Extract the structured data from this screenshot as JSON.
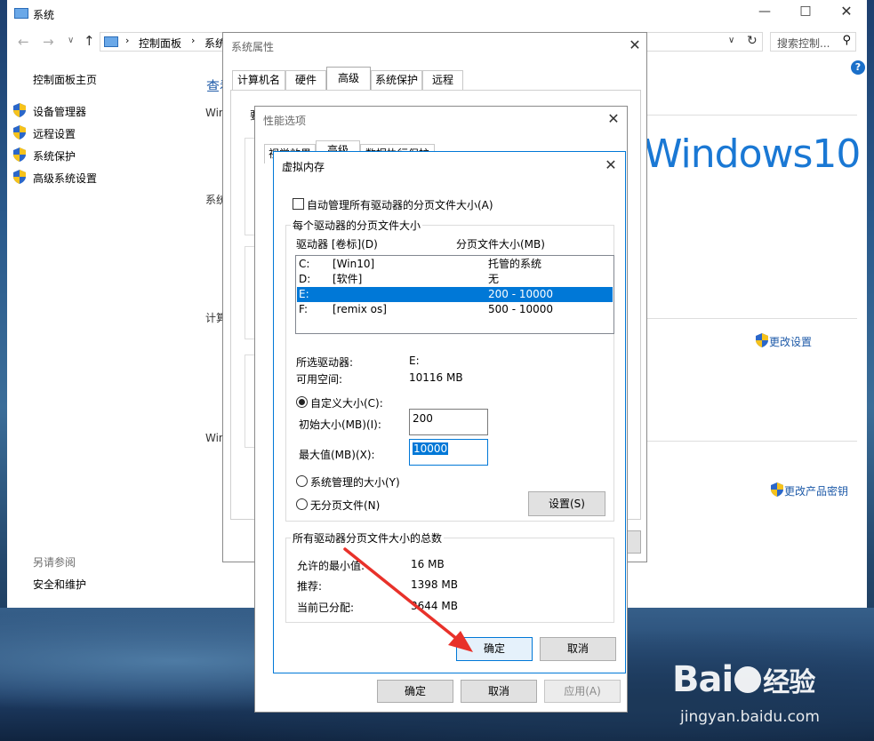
{
  "system_window": {
    "title": "系统",
    "address": {
      "crumb1": "控制面板",
      "crumb2": "系统"
    },
    "search_placeholder": "搜索控制...",
    "sidebar": {
      "home": "控制面板主页",
      "items": [
        {
          "label": "设备管理器"
        },
        {
          "label": "远程设置"
        },
        {
          "label": "系统保护"
        },
        {
          "label": "高级系统设置"
        }
      ],
      "see_also": "另请参阅",
      "security": "安全和维护"
    },
    "main": {
      "heading_fragment": "查看",
      "win_label_1": "Win",
      "sys_label": "系统",
      "calc_label": "计算",
      "win_label_2": "Win",
      "brand": "Windows10",
      "change_settings": "更改设置",
      "change_key": "更改产品密钥"
    }
  },
  "sys_props": {
    "title": "系统属性",
    "tabs": [
      "计算机名",
      "硬件",
      "高级",
      "系统保护",
      "远程"
    ],
    "stub_text": "要",
    "buttons": {
      "ok": "确定",
      "cancel": "取消",
      "apply": "应用(A)"
    }
  },
  "perf_options": {
    "title": "性能选项",
    "tabs": [
      "视觉效果",
      "高级",
      "数据执行保护"
    ]
  },
  "vm": {
    "title": "虚拟内存",
    "auto_manage": "自动管理所有驱动器的分页文件大小(A)",
    "per_drive_group": "每个驱动器的分页文件大小",
    "col_drive": "驱动器 [卷标](D)",
    "col_size": "分页文件大小(MB)",
    "drives": [
      {
        "letter": "C:",
        "label": "[Win10]",
        "size": "托管的系统"
      },
      {
        "letter": "D:",
        "label": "[软件]",
        "size": "无"
      },
      {
        "letter": "E:",
        "label": "",
        "size": "200 - 10000"
      },
      {
        "letter": "F:",
        "label": "[remix os]",
        "size": "500 - 10000"
      }
    ],
    "selected_drive_label": "所选驱动器:",
    "selected_drive_value": "E:",
    "free_space_label": "可用空间:",
    "free_space_value": "10116 MB",
    "custom_size": "自定义大小(C):",
    "initial_label": "初始大小(MB)(I):",
    "initial_value": "200",
    "max_label": "最大值(MB)(X):",
    "max_value": "10000",
    "system_managed": "系统管理的大小(Y)",
    "no_paging": "无分页文件(N)",
    "set_button": "设置(S)",
    "totals_group": "所有驱动器分页文件大小的总数",
    "min_allowed_label": "允许的最小值:",
    "min_allowed_value": "16 MB",
    "recommended_label": "推荐:",
    "recommended_value": "1398 MB",
    "allocated_label": "当前已分配:",
    "allocated_value": "3644 MB",
    "ok": "确定",
    "cancel": "取消"
  },
  "watermark": {
    "brand": "Bai",
    "brand2": "经验",
    "url": "jingyan.baidu.com"
  },
  "colors": {
    "accent": "#0078d7",
    "arrow": "#e8312a"
  }
}
